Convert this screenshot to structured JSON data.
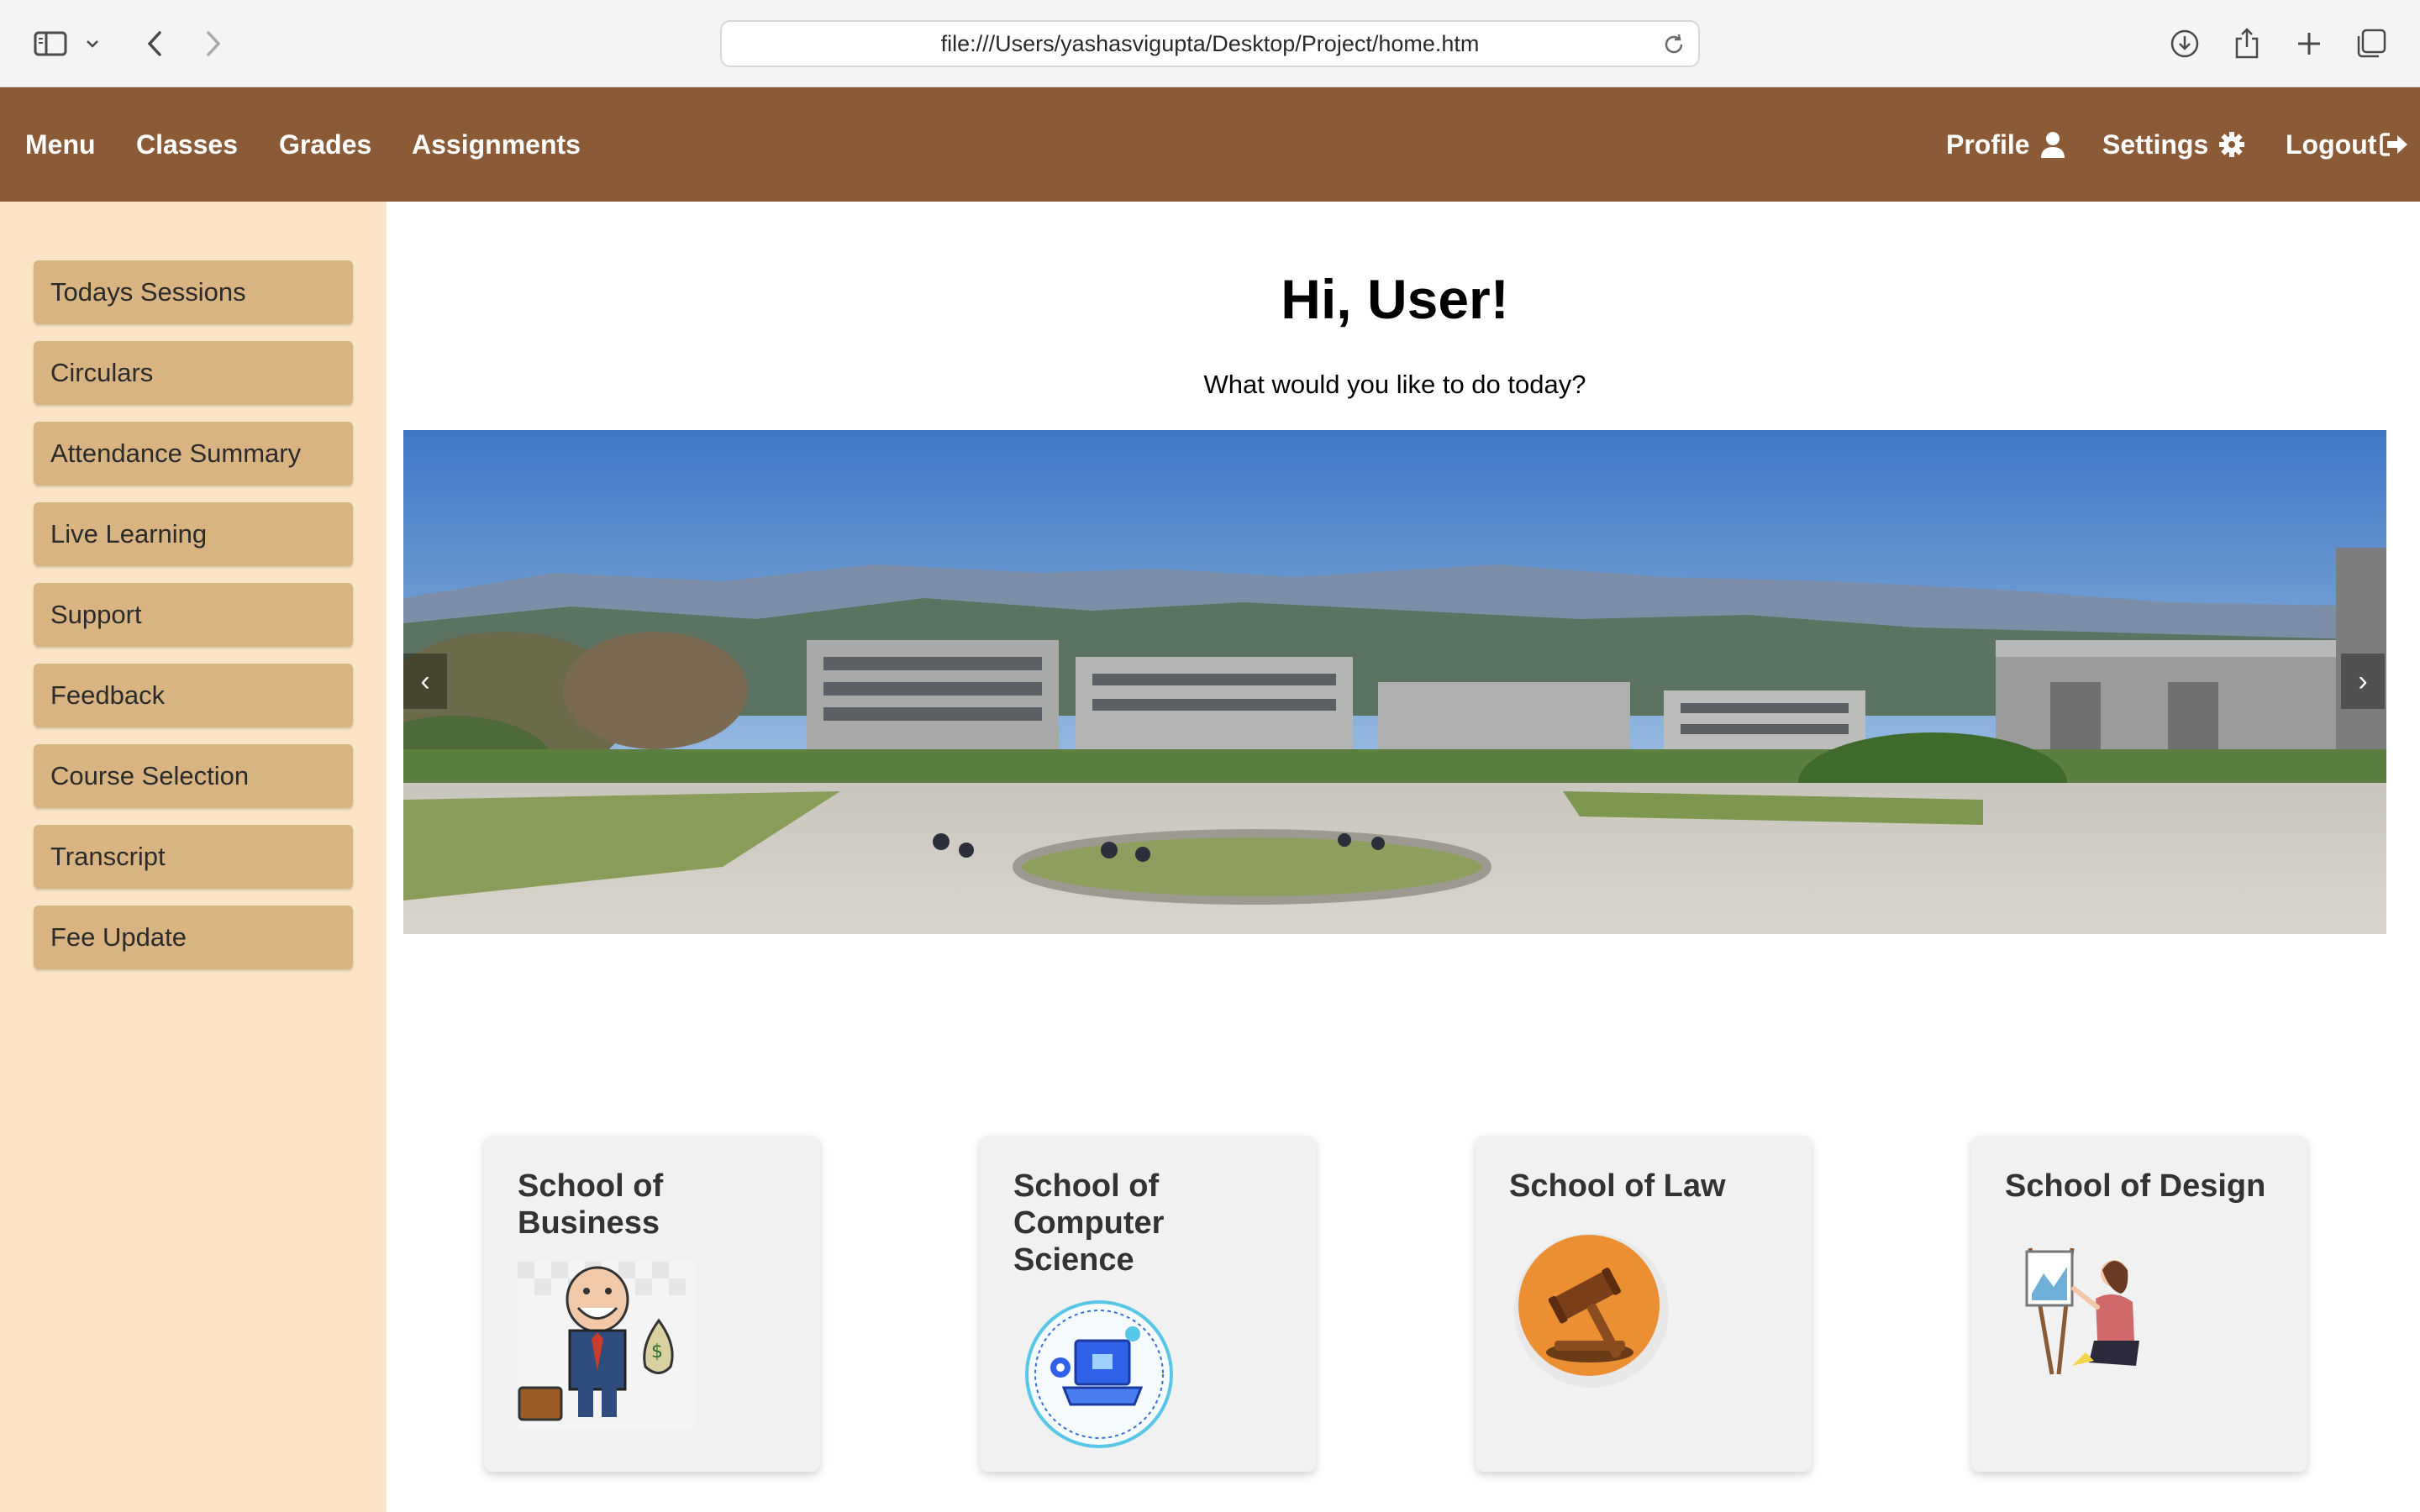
{
  "browser": {
    "url": "file:///Users/yashasvigupta/Desktop/Project/home.htm"
  },
  "nav": {
    "left": [
      "Menu",
      "Classes",
      "Grades",
      "Assignments"
    ],
    "profile": "Profile",
    "settings": "Settings",
    "logout": "Logout"
  },
  "sidebar": {
    "items": [
      "Todays Sessions",
      "Circulars",
      "Attendance Summary",
      "Live Learning",
      "Support",
      "Feedback",
      "Course Selection",
      "Transcript",
      "Fee Update"
    ]
  },
  "main": {
    "greeting": "Hi, User!",
    "subtitle": "What would you like to do today?",
    "carousel": {
      "prev": "‹",
      "next": "›"
    },
    "schools": [
      "School of Business",
      "School of Computer Science",
      "School of Law",
      "School of Design"
    ]
  },
  "colors": {
    "nav": "#8b5a37",
    "sidebar": "#fce4c6",
    "sidebar_button": "#d9b483",
    "card": "#f1f1f1"
  }
}
